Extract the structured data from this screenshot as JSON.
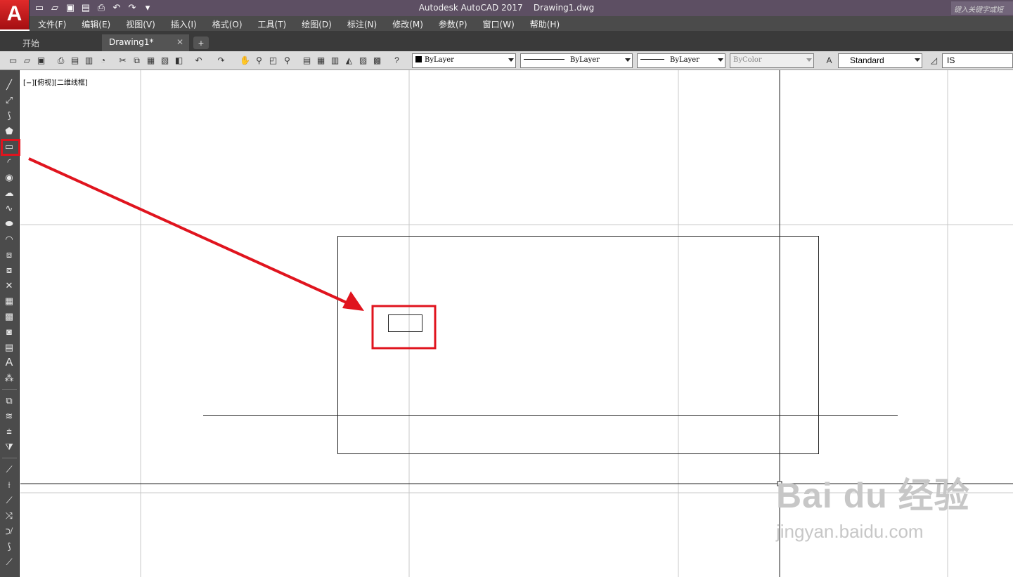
{
  "app": {
    "title": "Autodesk AutoCAD 2017",
    "file": "Drawing1.dwg",
    "logo_letter": "A",
    "search_placeholder": "键入关键字或短"
  },
  "menu": [
    "文件(F)",
    "编辑(E)",
    "视图(V)",
    "插入(I)",
    "格式(O)",
    "工具(T)",
    "绘图(D)",
    "标注(N)",
    "修改(M)",
    "参数(P)",
    "窗口(W)",
    "帮助(H)"
  ],
  "tabs": {
    "start": "开始",
    "drawing": "Drawing1*",
    "close": "✕",
    "add": "+"
  },
  "toolbar": {
    "color": "ByLayer",
    "linetype": "ByLayer",
    "lineweight": "ByLayer",
    "plotstyle": "ByColor",
    "textstyle": "Standard",
    "dimstyle": "IS"
  },
  "viewport": {
    "label": "[−][俯视][二维线框]"
  },
  "watermark": {
    "brand": "Bai du 经验",
    "url": "jingyan.baidu.com"
  },
  "colors": {
    "highlight": "#e0141e",
    "title_bg": "#5d4f63",
    "menu_bg": "#4b4b4b"
  }
}
